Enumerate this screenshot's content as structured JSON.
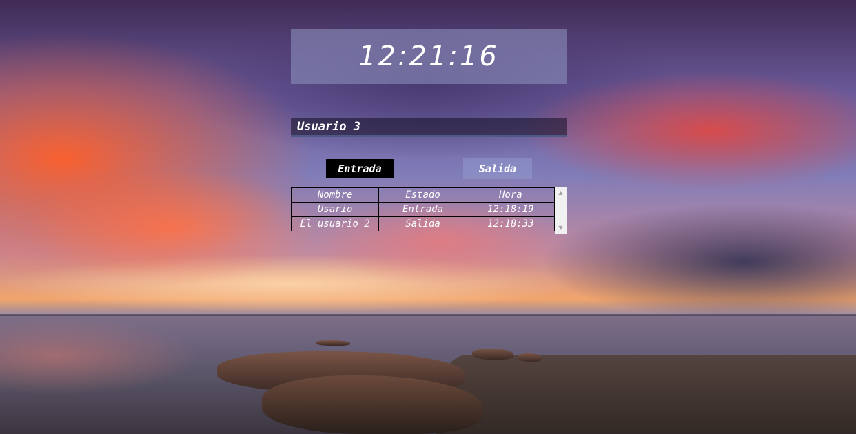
{
  "clock": {
    "time": "12:21:16"
  },
  "user_input": {
    "value": "Usuario 3"
  },
  "buttons": {
    "entrada": "Entrada",
    "salida": "Salida"
  },
  "table": {
    "headers": [
      "Nombre",
      "Estado",
      "Hora"
    ],
    "rows": [
      [
        "Usario",
        "Entrada",
        "12:18:19"
      ],
      [
        "El usuario 2",
        "Salida",
        "12:18:33"
      ]
    ]
  },
  "scrollbar": {
    "up_icon": "triangle-up",
    "down_icon": "triangle-down"
  },
  "colors": {
    "clock_panel": "#969ec8",
    "entrada_button": "#000000",
    "salida_button": "#96a0d2",
    "text": "#ffffff"
  }
}
